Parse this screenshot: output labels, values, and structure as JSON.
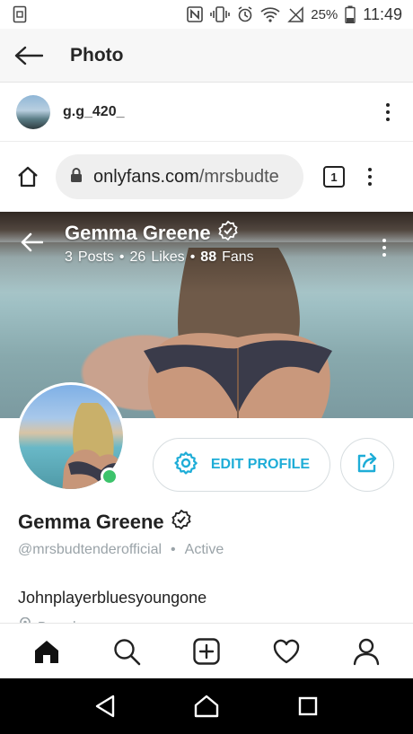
{
  "status_bar": {
    "battery_percent": "25%",
    "time": "11:49",
    "icons": [
      "screenshot-icon",
      "nfc-icon",
      "vibrate-icon",
      "alarm-icon",
      "wifi-icon",
      "no-signal-icon",
      "battery-icon"
    ]
  },
  "app_header": {
    "title": "Photo",
    "back_icon": "arrow-left-icon"
  },
  "post": {
    "author": "g.g_420_",
    "more_icon": "more-vertical-icon"
  },
  "browser": {
    "url_host": "onlyfans.com",
    "url_path": "/mrsbudte",
    "tab_count": "1",
    "home_icon": "home-outline-icon",
    "lock_icon": "lock-icon"
  },
  "profile": {
    "name": "Gemma Greene",
    "posts_count": "3",
    "posts_label": "Posts",
    "likes_count": "26",
    "likes_label": "Likes",
    "fans_count": "88",
    "fans_label": "Fans",
    "separator": "•",
    "edit_label": "EDIT PROFILE",
    "handle": "@mrsbudtenderofficial",
    "status": "Active",
    "bio": "Johnplayerbluesyoungone",
    "location": "Barcelona"
  },
  "colors": {
    "accent": "#1eadd7",
    "online": "#3cc36b",
    "muted": "#9aa3a8"
  },
  "bottom_nav": [
    "home-icon",
    "search-icon",
    "add-post-icon",
    "heart-icon",
    "user-icon"
  ],
  "system_nav": [
    "back-triangle-icon",
    "home-circle-icon",
    "recents-square-icon"
  ]
}
